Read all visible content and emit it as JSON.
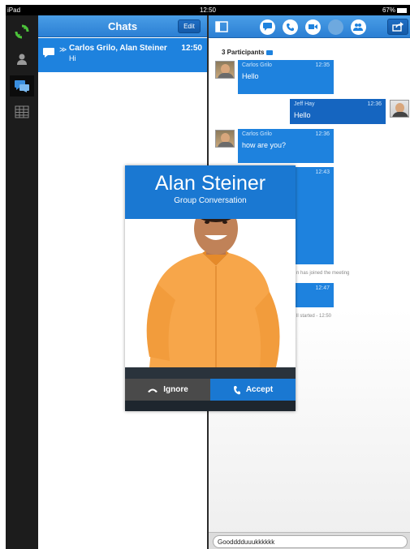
{
  "status_bar": {
    "device": "iPad",
    "time": "12:50",
    "battery": "67%"
  },
  "rail": {
    "items": [
      {
        "icon": "refresh-icon"
      },
      {
        "icon": "contacts-icon"
      },
      {
        "icon": "chats-icon",
        "active": true
      },
      {
        "icon": "calendar-grid-icon"
      }
    ]
  },
  "chats_panel": {
    "title": "Chats",
    "edit_label": "Edit",
    "items": [
      {
        "name": "Carlos Grilo, Alan Steiner",
        "time": "12:50",
        "preview": "Hi"
      }
    ]
  },
  "conversation": {
    "participants_label": "3 Participants",
    "toolbar_icons": [
      "panel-toggle-icon",
      "chat-icon",
      "phone-icon",
      "video-icon",
      "screen-share-icon",
      "add-participant-icon",
      "share-icon"
    ],
    "messages": [
      {
        "sender": "Carlos Grilo",
        "time": "12:35",
        "text": "Hello",
        "direction": "in"
      },
      {
        "sender": "Jeff Hay",
        "time": "12:36",
        "text": "Hello",
        "direction": "out"
      },
      {
        "sender": "Carlos Grilo",
        "time": "12:36",
        "text": "how are you?",
        "direction": "in"
      },
      {
        "sender": "",
        "time": "12:43",
        "text": "",
        "direction": "in"
      },
      {
        "sender": "",
        "time": "12:47",
        "text": "",
        "direction": "in"
      }
    ],
    "system_joined": "n has joined the meeting",
    "system_started": "ll started - 12:50",
    "input_value": "Goodddduuukkkkkk"
  },
  "incoming_call": {
    "caller_name": "Alan Steiner",
    "subtitle": "Group Conversation",
    "ignore_label": "Ignore",
    "accept_label": "Accept"
  },
  "colors": {
    "accent": "#1e82de",
    "header_blue": "#2b7fd4",
    "rail_bg": "#1c1c1c",
    "refresh_green": "#4cc23a",
    "shirt_orange": "#f7a64a"
  }
}
